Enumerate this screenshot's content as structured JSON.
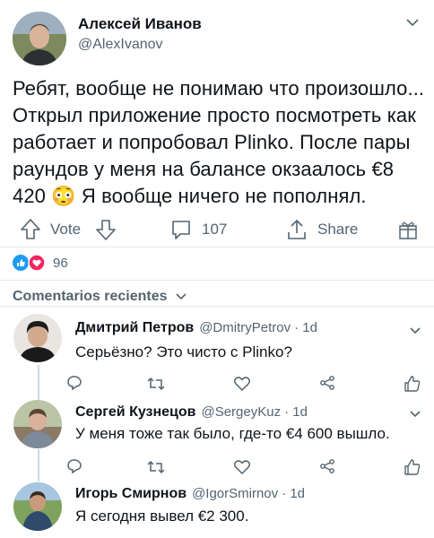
{
  "post": {
    "author_name": "Алексей Иванов",
    "author_handle": "@AlexIvanov",
    "text_line1": "Ребят, вообще не понимаю что произошло...",
    "text_line2": "Открыл приложение просто посмотреть как",
    "text_line3": "работает и попробовал Plinko. После пары",
    "text_line4": "раундов у меня на балансе окзаалось €8",
    "text_line5": "420 😳 Я вообще ничего не пополнял.",
    "vote_label": "Vote",
    "comments_count": "107",
    "share_label": "Share",
    "reactions_count": "96"
  },
  "comments_section": {
    "title": "Comentarios recientes"
  },
  "replies": [
    {
      "name": "Дмитрий Петров",
      "handle": "@DmitryPetrov",
      "time": "· 1d",
      "text": "Серьёзно? Это чисто с Plinko?"
    },
    {
      "name": "Сергей Кузнецов",
      "handle": "@SergeyKuz",
      "time": "· 1d",
      "text": "У меня тоже так было, где-то €4 600 вышло."
    },
    {
      "name": "Игорь Смирнов",
      "handle": "@IgorSmirnov",
      "time": "· 1d",
      "text": "Я сегодня вывел €2 300."
    }
  ],
  "colors": {
    "like_red": "#f91880",
    "reaction_blue": "#1d9bf0",
    "muted_gray": "#536471"
  }
}
